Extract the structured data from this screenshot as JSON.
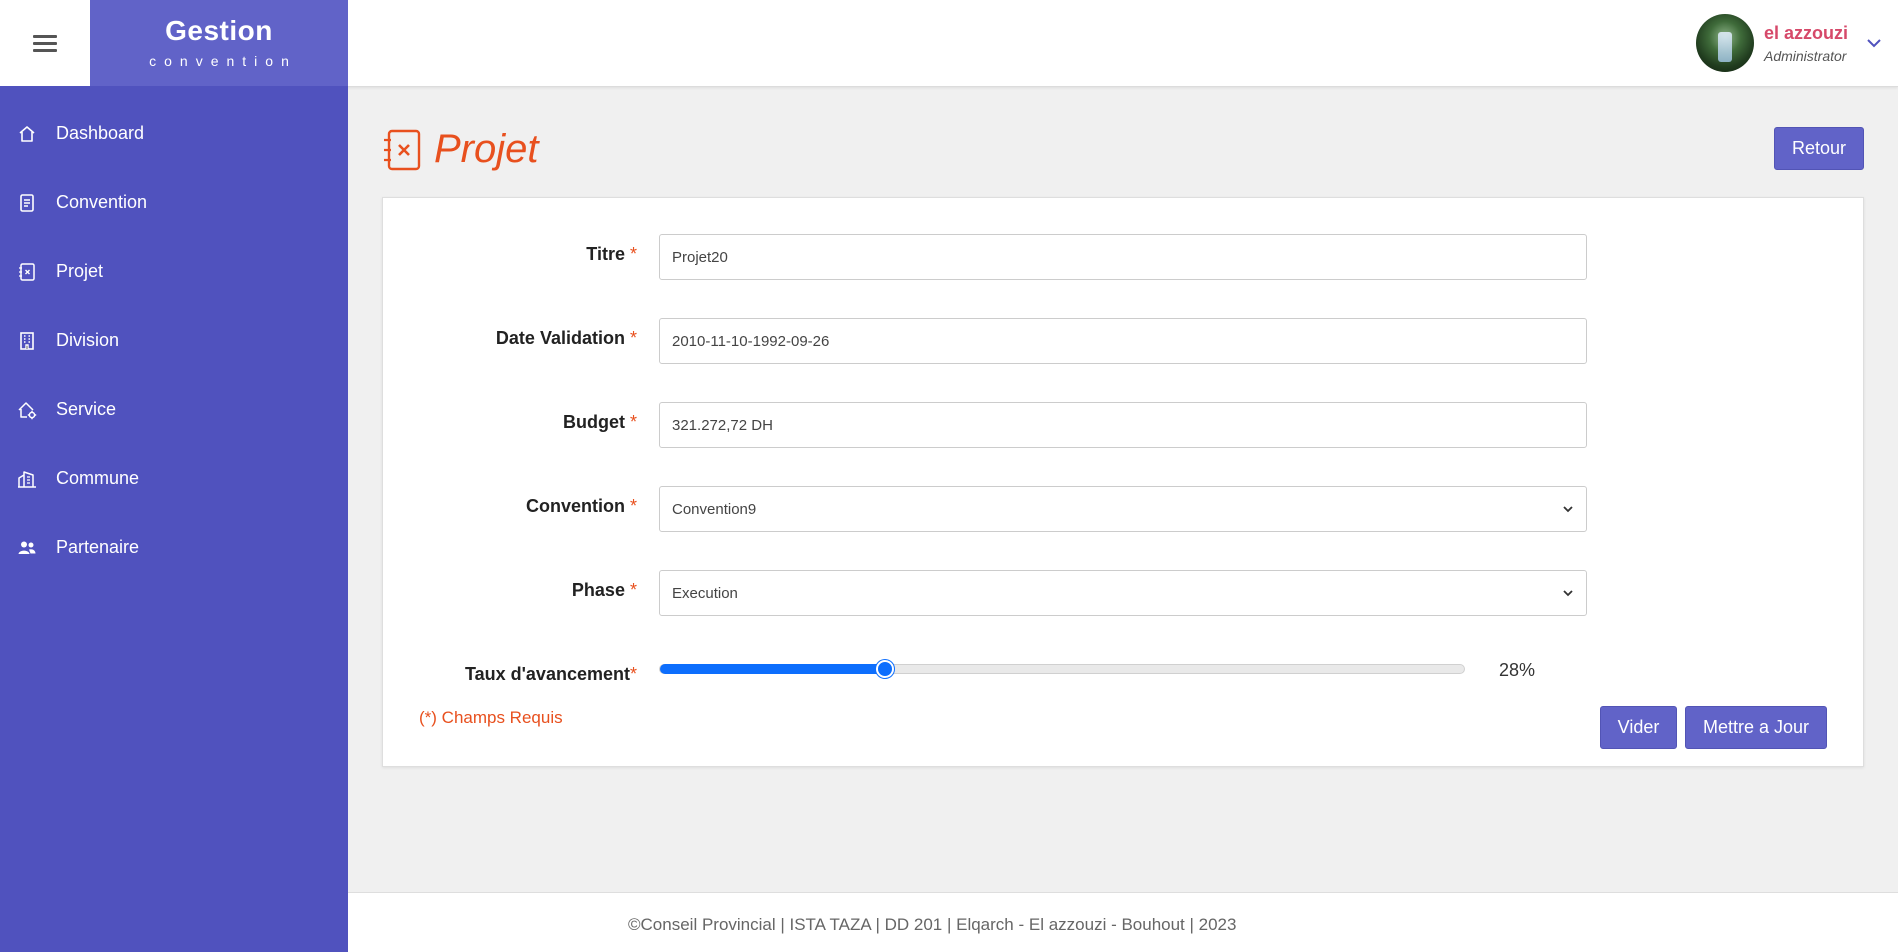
{
  "brand": {
    "title": "Gestion",
    "subtitle": "convention"
  },
  "user": {
    "name": "el azzouzi",
    "role": "Administrator"
  },
  "sidebar": {
    "items": [
      {
        "label": "Dashboard",
        "icon": "house-icon"
      },
      {
        "label": "Convention",
        "icon": "document-icon"
      },
      {
        "label": "Projet",
        "icon": "project-icon"
      },
      {
        "label": "Division",
        "icon": "building-icon"
      },
      {
        "label": "Service",
        "icon": "house-gear-icon"
      },
      {
        "label": "Commune",
        "icon": "city-icon"
      },
      {
        "label": "Partenaire",
        "icon": "people-icon"
      }
    ]
  },
  "page": {
    "title": "Projet",
    "back_label": "Retour"
  },
  "form": {
    "required_mark": "*",
    "titre": {
      "label": "Titre",
      "value": "Projet20"
    },
    "date_validation": {
      "label": "Date Validation",
      "value": "2010-11-10-1992-09-26"
    },
    "budget": {
      "label": "Budget",
      "value": "321.272,72 DH"
    },
    "convention": {
      "label": "Convention",
      "value": "Convention9"
    },
    "phase": {
      "label": "Phase",
      "value": "Execution"
    },
    "taux": {
      "label": "Taux d'avancement",
      "value": 28,
      "display": "28%"
    },
    "required_note": "(*) Champs Requis",
    "clear_label": "Vider",
    "update_label": "Mettre a Jour"
  },
  "footer": {
    "text": "©Conseil Provincial | ISTA TAZA | DD 201 | Elqarch - El azzouzi - Bouhout | 2023"
  },
  "colors": {
    "sidebar": "#5052be",
    "brand": "#6163c8",
    "accent": "#e8501e",
    "slider": "#0d6efd",
    "username": "#d6496a"
  }
}
